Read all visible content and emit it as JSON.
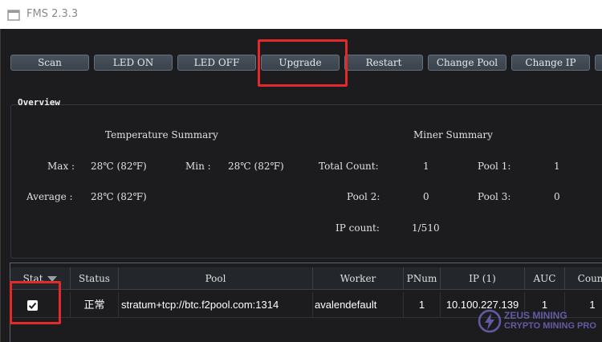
{
  "window": {
    "title": "FMS 2.3.3"
  },
  "toolbar": {
    "buttons": [
      "Scan",
      "LED ON",
      "LED OFF",
      "Upgrade",
      "Restart",
      "Change Pool",
      "Change IP"
    ]
  },
  "overview": {
    "label": "Overview",
    "temperature_summary": {
      "heading": "Temperature Summary",
      "max_label": "Max :",
      "max_value": "28℃ (82℉)",
      "min_label": "Min :",
      "min_value": "28℃ (82℉)",
      "average_label": "Average :",
      "average_value": "28℃ (82℉)"
    },
    "miner_summary": {
      "heading": "Miner Summary",
      "total_count_label": "Total Count:",
      "total_count_value": "1",
      "pool1_label": "Pool 1:",
      "pool1_value": "1",
      "pool2_label": "Pool 2:",
      "pool2_value": "0",
      "pool3_label": "Pool 3:",
      "pool3_value": "0",
      "ip_count_label": "IP count:",
      "ip_count_value": "1/510"
    }
  },
  "table": {
    "headers": [
      "Stat",
      "Status",
      "Pool",
      "Worker",
      "PNum",
      "IP (1)",
      "AUC",
      "Count"
    ],
    "rows": [
      {
        "checked": true,
        "status": "正常",
        "pool": "stratum+tcp://btc.f2pool.com:1314",
        "worker": "avalendefault",
        "pnum": "1",
        "ip": "10.100.227.139",
        "auc": "1",
        "count": "1"
      }
    ]
  },
  "watermark": {
    "line1": "ZEUS MINING",
    "line2": "CRYPTO MINING PRO"
  },
  "colors": {
    "background": "#1c1c1f",
    "button": "#48525c",
    "highlight": "#e22a2a",
    "watermark": "#7a6fd0"
  }
}
